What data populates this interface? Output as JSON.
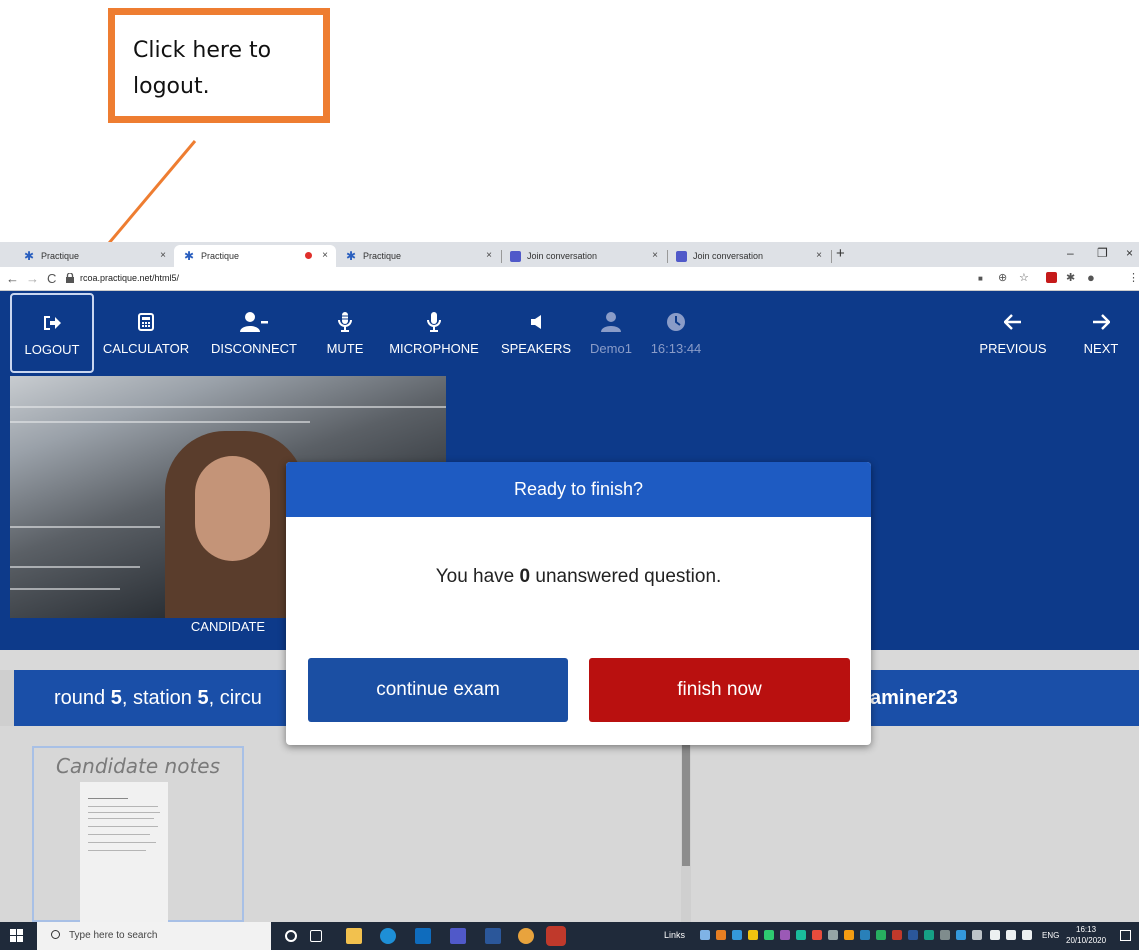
{
  "callout": {
    "text": "Click here to\nlogout."
  },
  "browser": {
    "tabs": [
      {
        "label": "Practique",
        "icon": "practique-icon",
        "close": "×"
      },
      {
        "label": "Practique",
        "icon": "practique-icon",
        "close": "×"
      },
      {
        "label": "Practique",
        "icon": "practique-icon",
        "close": "×"
      },
      {
        "label": "Join conversation",
        "icon": "teams-icon",
        "close": "×"
      },
      {
        "label": "Join conversation",
        "icon": "teams-icon",
        "close": "×"
      }
    ],
    "new_tab": "+",
    "window_controls": {
      "minimize": "–",
      "restore": "❐",
      "close": "×"
    },
    "url": "rcoa.practique.net/html5/",
    "nav": {
      "back": "←",
      "forward": "→",
      "reload": "C"
    }
  },
  "toolbar": {
    "logout": "LOGOUT",
    "calculator": "CALCULATOR",
    "disconnect": "DISCONNECT",
    "mute": "MUTE",
    "microphone": "MICROPHONE",
    "speakers": "SPEAKERS",
    "user": "Demo1",
    "time": "16:13:44",
    "previous": "PREVIOUS",
    "next": "NEXT"
  },
  "video": {
    "label": "CANDIDATE"
  },
  "exam": {
    "round_prefix": "round ",
    "round": "5",
    "station_prefix": ", station ",
    "station": "5",
    "circuit_fragment": ", circu",
    "examiner_fragment": "aminer23",
    "notes_title": "Candidate notes"
  },
  "modal": {
    "title": "Ready to finish?",
    "msg_prefix": "You have ",
    "count": "0",
    "msg_suffix": " unanswered question.",
    "continue_label": "continue exam",
    "finish_label": "finish now"
  },
  "taskbar": {
    "search_placeholder": "Type here to search",
    "links": "Links",
    "lang": "ENG",
    "time": "16:13",
    "date": "20/10/2020"
  },
  "colors": {
    "app_blue": "#0d3a8a",
    "modal_header": "#1e5bc2",
    "continue_button": "#1b4fa3",
    "finish_button": "#b9100f",
    "callout_border": "#ee7d31"
  }
}
